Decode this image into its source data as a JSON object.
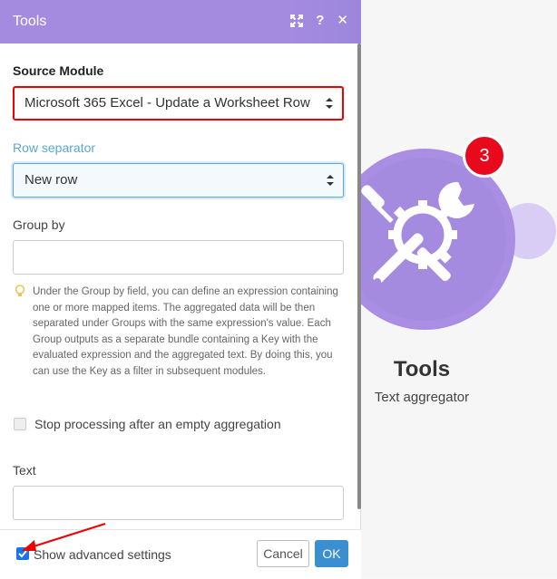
{
  "panel": {
    "title": "Tools",
    "help_icon": "?",
    "close_icon": "✕"
  },
  "form": {
    "source_module": {
      "label": "Source Module",
      "value": "Microsoft 365 Excel - Update a Worksheet Row"
    },
    "row_separator": {
      "label": "Row separator",
      "value": "New row"
    },
    "group_by": {
      "label": "Group by",
      "value": "",
      "help": "Under the Group by field, you can define an expression containing one or more mapped items. The aggregated data will be then separated under Groups with the same expression's value. Each Group outputs as a separate bundle containing a Key with the evaluated expression and the aggregated text. By doing this, you can use the Key as a filter in subsequent modules."
    },
    "stop_processing": {
      "label": "Stop processing after an empty aggregation",
      "checked": false
    },
    "text": {
      "label": "Text",
      "value": ""
    }
  },
  "footer": {
    "advanced_label": "Show advanced settings",
    "advanced_checked": true,
    "cancel_label": "Cancel",
    "ok_label": "OK"
  },
  "module": {
    "badge": "3",
    "title": "Tools",
    "subtitle": "Text aggregator",
    "icon": "wrench-screwdriver-gear-icon",
    "color": "#a48be0"
  },
  "colors": {
    "header": "#a48be0",
    "accent_blue": "#3a8fd0",
    "error_red": "#e00000",
    "badge_red": "#e8091c"
  }
}
